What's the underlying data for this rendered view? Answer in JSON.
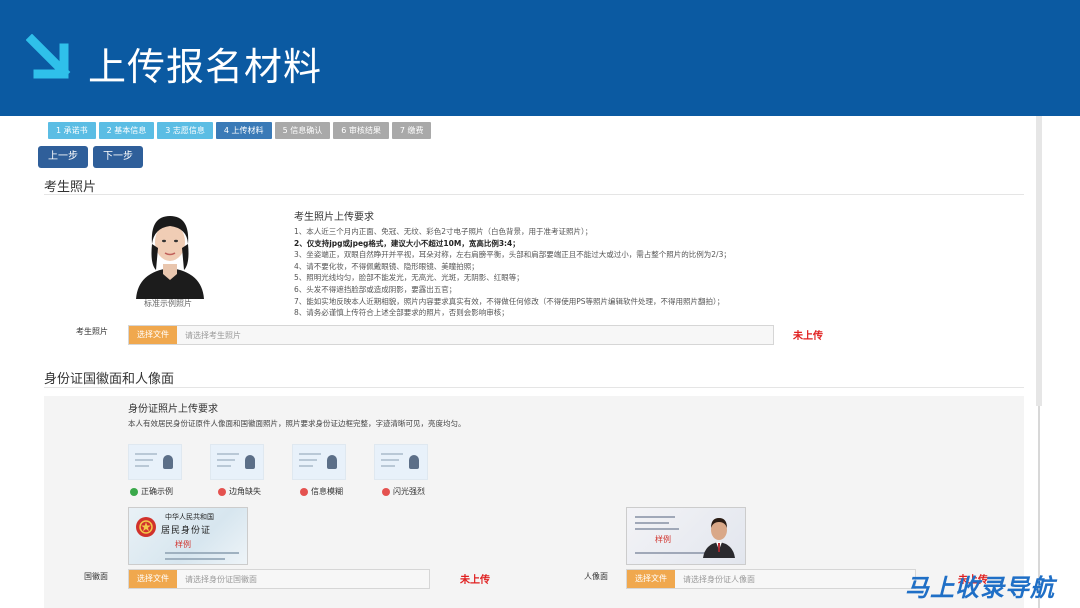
{
  "banner": {
    "title": "上传报名材料"
  },
  "steps": [
    {
      "label": "1 承诺书",
      "state": "done"
    },
    {
      "label": "2 基本信息",
      "state": "done"
    },
    {
      "label": "3 志愿信息",
      "state": "done"
    },
    {
      "label": "4 上传材料",
      "state": "active"
    },
    {
      "label": "5 信息确认",
      "state": "todo"
    },
    {
      "label": "6 审核结果",
      "state": "todo"
    },
    {
      "label": "7 缴费",
      "state": "todo"
    }
  ],
  "nav": {
    "prev_label": "上一步",
    "next_label": "下一步"
  },
  "photo_section": {
    "title": "考生照片",
    "sample_caption": "标准示例照片",
    "req_title": "考生照片上传要求",
    "requirements": [
      "1、本人近三个月内正面、免冠、无纹、彩色2寸电子照片（白色背景，用于准考证照片）；",
      "2、仅支持jpg或jpeg格式，建议大小不超过10M，宽高比例3:4；",
      "3、坐姿端正，双眼自然睁开并平视，耳朵对称，左右肩膀平衡，头部和肩部要端正且不能过大或过小，需占整个照片的比例为2/3；",
      "4、请不要化妆，不得佩戴眼镜、隐形眼镜、美瞳拍照；",
      "5、照明光线均匀，脸部不能发光，无高光、光斑，无阴影、红眼等；",
      "6、头发不得遮挡脸部或造成阴影，要露出五官；",
      "7、能如实地反映本人近期相貌，照片内容要求真实有效，不得做任何修改（不得使用PS等照片编辑软件处理，不得用照片翻拍）；",
      "8、请务必谨慎上传符合上述全部要求的照片，否则会影响审核；"
    ],
    "field_label": "考生照片",
    "choose_label": "选择文件",
    "placeholder": "请选择考生照片",
    "status": "未上传"
  },
  "id_section": {
    "title": "身份证国徽面和人像面",
    "req_title": "身份证照片上传要求",
    "req_desc": "本人有效居民身份证原件人像面和国徽面照片，照片要求身份证边框完整，字迹清晰可见，亮度均匀。",
    "samples": [
      {
        "label": "正确示例",
        "ok": true
      },
      {
        "label": "边角缺失",
        "ok": false
      },
      {
        "label": "信息模糊",
        "ok": false
      },
      {
        "label": "闪光强烈",
        "ok": false
      }
    ],
    "emblem_card": {
      "line1": "中华人民共和国",
      "line2": "居民身份证",
      "stamp": "样例"
    },
    "portrait_card": {
      "stamp": "样例"
    },
    "emblem_label": "国徽面",
    "emblem_placeholder": "请选择身份证国徽面",
    "portrait_label": "人像面",
    "portrait_placeholder": "请选择身份证人像面",
    "choose_label": "选择文件",
    "status": "未上传"
  },
  "watermark": "马上收录导航",
  "colors": {
    "banner": "#0b5aa2",
    "accent_orange": "#f0a84e",
    "status_red": "#e02020",
    "step_done": "#5bbde4",
    "step_active": "#3a7ab7"
  }
}
